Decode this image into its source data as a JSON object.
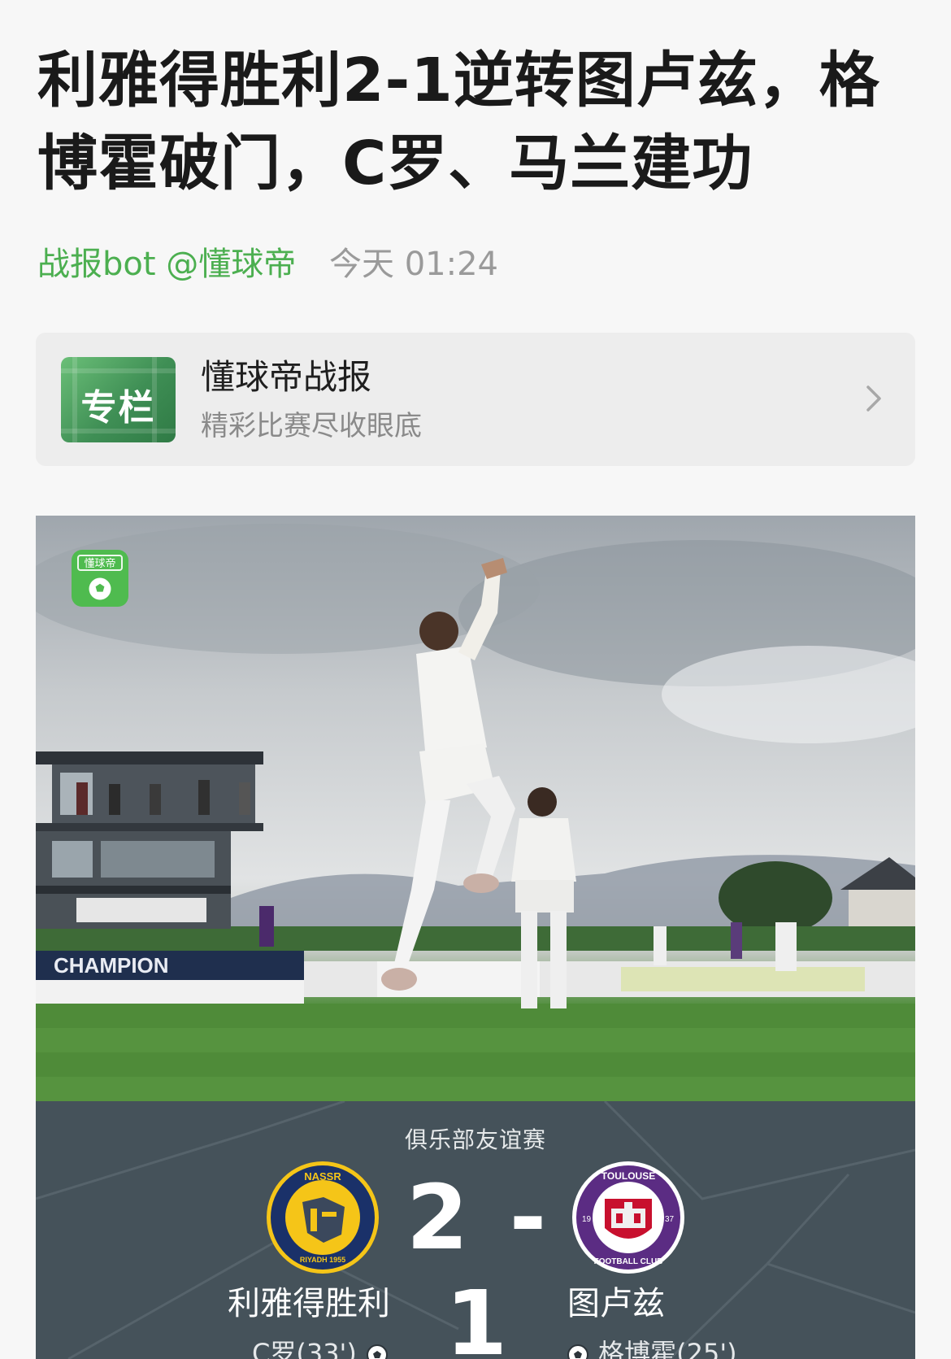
{
  "article": {
    "title": "利雅得胜利2-1逆转图卢兹，格博霍破门，C罗、马兰建功",
    "author": "战报bot @懂球帝",
    "time": "今天 01:24"
  },
  "column": {
    "thumb_label": "专栏",
    "name": "懂球帝战报",
    "subtitle": "精彩比赛尽收眼底"
  },
  "hero_image": {
    "watermark_text": "懂球帝",
    "banner_text": "CHAMPION"
  },
  "match": {
    "competition": "俱乐部友谊赛",
    "score": "2 - 1",
    "home": {
      "name": "利雅得胜利",
      "crest_top_text": "NASSR",
      "crest_bottom_text": "RIYADH 1955",
      "scorer": "C罗(33')",
      "crest_color": "#f5c518"
    },
    "away": {
      "name": "图卢兹",
      "crest_top_text": "TOULOUSE",
      "crest_bottom_text": "FOOTBALL CLUB",
      "crest_year_left": "19",
      "crest_year_right": "37",
      "scorer": "格博霍(25')",
      "crest_color": "#5b2c83"
    }
  },
  "colors": {
    "accent_green": "#4caf50",
    "muted_gray": "#9a9a9a",
    "panel_slate": "#45525a"
  }
}
